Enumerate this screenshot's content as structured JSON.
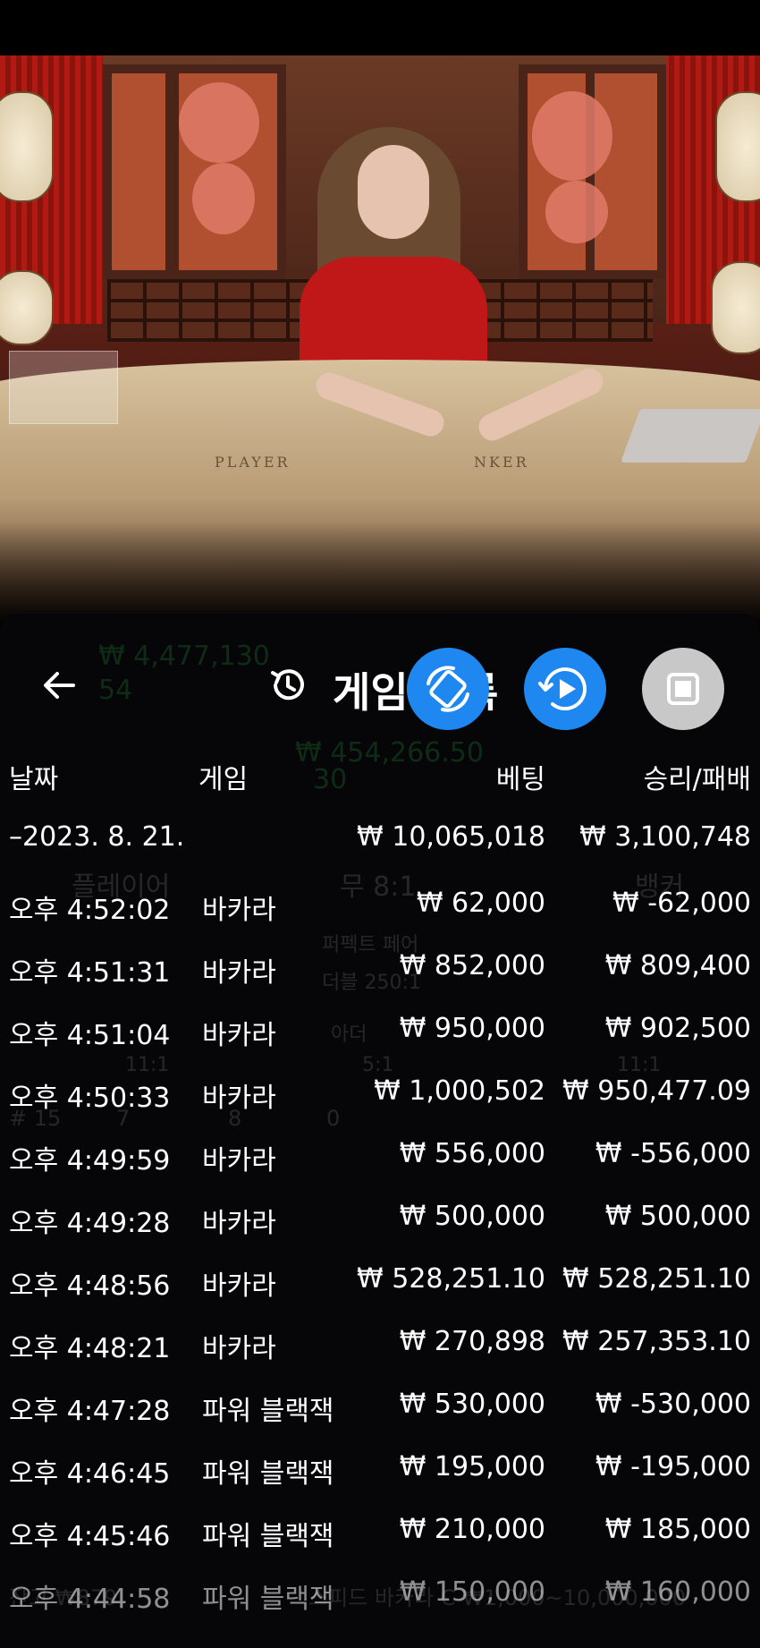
{
  "video": {
    "table_labels": {
      "player": "PLAYER",
      "banker": "NKER"
    }
  },
  "background_overlay": {
    "player_amount": "₩ 4,477,130",
    "player_count": "54",
    "center_amount": "₩ 454,266.50",
    "center_count": "30",
    "player_label": "플레이어",
    "tie_label": "무 8:1",
    "banker_label": "뱅커",
    "perfect_pair": "퍼펙트 페어",
    "double": "더블 250:1",
    "either_pair": "아더",
    "odds_left": "11:1",
    "odds_mid": "5:1",
    "odds_right": "11:1",
    "round_no": "# 15",
    "count_p": "7",
    "count_b": "8",
    "count_t": "0",
    "balance": "잔고 ₩879",
    "table_name": "스피드 바카라 C ₩1,000~10,000,000"
  },
  "header": {
    "back_icon": "arrow-left-icon",
    "history_icon": "history-icon",
    "title": "게임 기록"
  },
  "columns": {
    "date": "날짜",
    "game": "게임",
    "bet": "베팅",
    "result": "승리/패배"
  },
  "summary": {
    "date": "–2023. 8. 21.",
    "bet": "₩ 10,065,018",
    "result": "₩ 3,100,748"
  },
  "rows": [
    {
      "time": "오후 4:52:02",
      "game": "바카라",
      "bet": "₩ 62,000",
      "result": "₩ -62,000"
    },
    {
      "time": "오후 4:51:31",
      "game": "바카라",
      "bet": "₩ 852,000",
      "result": "₩ 809,400"
    },
    {
      "time": "오후 4:51:04",
      "game": "바카라",
      "bet": "₩ 950,000",
      "result": "₩ 902,500"
    },
    {
      "time": "오후 4:50:33",
      "game": "바카라",
      "bet": "₩ 1,000,502",
      "result": "₩ 950,477.09"
    },
    {
      "time": "오후 4:49:59",
      "game": "바카라",
      "bet": "₩ 556,000",
      "result": "₩ -556,000"
    },
    {
      "time": "오후 4:49:28",
      "game": "바카라",
      "bet": "₩ 500,000",
      "result": "₩ 500,000"
    },
    {
      "time": "오후 4:48:56",
      "game": "바카라",
      "bet": "₩ 528,251.10",
      "result": "₩ 528,251.10"
    },
    {
      "time": "오후 4:48:21",
      "game": "바카라",
      "bet": "₩ 270,898",
      "result": "₩ 257,353.10"
    },
    {
      "time": "오후 4:47:28",
      "game": "파워 블랙잭",
      "bet": "₩ 530,000",
      "result": "₩ -530,000"
    },
    {
      "time": "오후 4:46:45",
      "game": "파워 블랙잭",
      "bet": "₩ 195,000",
      "result": "₩ -195,000"
    },
    {
      "time": "오후 4:45:46",
      "game": "파워 블랙잭",
      "bet": "₩ 210,000",
      "result": "₩ 185,000"
    },
    {
      "time": "오후 4:44:58",
      "game": "파워 블랙잭",
      "bet": "₩ 150,000",
      "result": "₩ 160,000"
    }
  ],
  "floating_buttons": {
    "rotate_icon": "screen-rotate-icon",
    "replay_icon": "video-replay-icon",
    "stop_icon": "stop-record-icon"
  },
  "colors": {
    "accent_blue": "#1e88f0",
    "panel_bg": "#06060a",
    "dealer_dress": "#c01818"
  }
}
